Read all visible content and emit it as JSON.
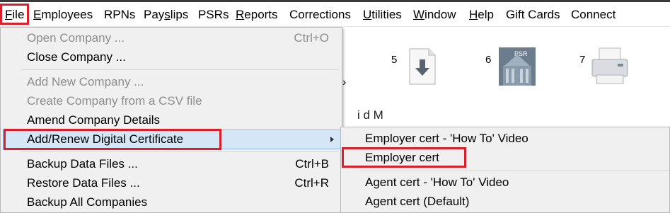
{
  "menubar": {
    "items": [
      {
        "pre": "",
        "u": "F",
        "post": "ile"
      },
      {
        "pre": "",
        "u": "E",
        "post": "mployees"
      },
      {
        "pre": "RPNs",
        "u": "",
        "post": ""
      },
      {
        "pre": "Pay",
        "u": "s",
        "post": "lips"
      },
      {
        "pre": "PSRs",
        "u": "",
        "post": ""
      },
      {
        "pre": "",
        "u": "R",
        "post": "eports"
      },
      {
        "pre": "Corrections",
        "u": "",
        "post": ""
      },
      {
        "pre": "",
        "u": "U",
        "post": "tilities"
      },
      {
        "pre": "",
        "u": "W",
        "post": "indow"
      },
      {
        "pre": "",
        "u": "H",
        "post": "elp"
      },
      {
        "pre": "Gift Cards",
        "u": "",
        "post": ""
      },
      {
        "pre": "Connect",
        "u": "",
        "post": ""
      }
    ]
  },
  "background": {
    "numbers": [
      "5",
      "6",
      "7"
    ],
    "icons": [
      "download-icon",
      "psr-building-icon",
      "printer-icon"
    ],
    "psr_label": "PSR",
    "partial_text": "i                              d                           M"
  },
  "file_menu": {
    "items": [
      {
        "label": "Open Company ...",
        "shortcut": "Ctrl+O",
        "disabled": true
      },
      {
        "label": "Close Company ...",
        "shortcut": "",
        "disabled": false
      },
      {
        "label": "Add New Company ...",
        "shortcut": "",
        "disabled": true
      },
      {
        "label": "Create Company from a CSV file",
        "shortcut": "",
        "disabled": true
      },
      {
        "label": "Amend Company Details",
        "shortcut": "",
        "disabled": false
      },
      {
        "label": "Add/Renew Digital Certificate",
        "shortcut": "",
        "disabled": false
      },
      {
        "label": "Backup Data Files ...",
        "shortcut": "Ctrl+B",
        "disabled": false
      },
      {
        "label": "Restore Data Files ...",
        "shortcut": "Ctrl+R",
        "disabled": false
      },
      {
        "label": "Backup All Companies",
        "shortcut": "",
        "disabled": false
      }
    ]
  },
  "submenu": {
    "items": [
      {
        "label": "Employer cert - 'How To' Video"
      },
      {
        "label": "Employer cert"
      },
      {
        "label": "Agent cert - 'How To' Video"
      },
      {
        "label": "Agent cert (Default)"
      }
    ]
  },
  "colors": {
    "highlight_border": "#d9202a",
    "hover_fill": "#d5e6f6",
    "menu_bg": "#f0f0f0",
    "disabled_text": "#8d8d8d"
  }
}
